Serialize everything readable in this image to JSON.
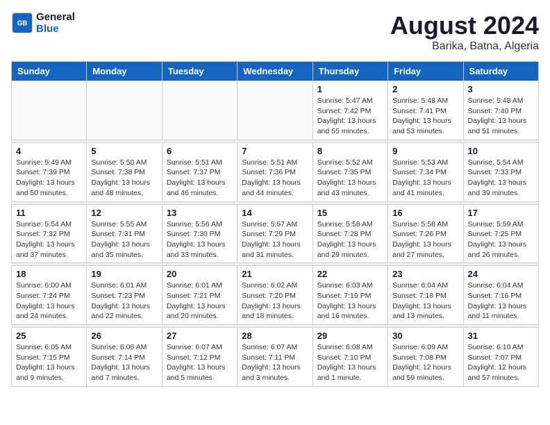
{
  "header": {
    "logo_line1": "General",
    "logo_line2": "Blue",
    "month_year": "August 2024",
    "location": "Barika, Batna, Algeria"
  },
  "weekdays": [
    "Sunday",
    "Monday",
    "Tuesday",
    "Wednesday",
    "Thursday",
    "Friday",
    "Saturday"
  ],
  "weeks": [
    [
      {
        "day": "",
        "detail": ""
      },
      {
        "day": "",
        "detail": ""
      },
      {
        "day": "",
        "detail": ""
      },
      {
        "day": "",
        "detail": ""
      },
      {
        "day": "1",
        "detail": "Sunrise: 5:47 AM\nSunset: 7:42 PM\nDaylight: 13 hours\nand 55 minutes."
      },
      {
        "day": "2",
        "detail": "Sunrise: 5:48 AM\nSunset: 7:41 PM\nDaylight: 13 hours\nand 53 minutes."
      },
      {
        "day": "3",
        "detail": "Sunrise: 5:48 AM\nSunset: 7:40 PM\nDaylight: 13 hours\nand 51 minutes."
      }
    ],
    [
      {
        "day": "4",
        "detail": "Sunrise: 5:49 AM\nSunset: 7:39 PM\nDaylight: 13 hours\nand 50 minutes."
      },
      {
        "day": "5",
        "detail": "Sunrise: 5:50 AM\nSunset: 7:38 PM\nDaylight: 13 hours\nand 48 minutes."
      },
      {
        "day": "6",
        "detail": "Sunrise: 5:51 AM\nSunset: 7:37 PM\nDaylight: 13 hours\nand 46 minutes."
      },
      {
        "day": "7",
        "detail": "Sunrise: 5:51 AM\nSunset: 7:36 PM\nDaylight: 13 hours\nand 44 minutes."
      },
      {
        "day": "8",
        "detail": "Sunrise: 5:52 AM\nSunset: 7:35 PM\nDaylight: 13 hours\nand 43 minutes."
      },
      {
        "day": "9",
        "detail": "Sunrise: 5:53 AM\nSunset: 7:34 PM\nDaylight: 13 hours\nand 41 minutes."
      },
      {
        "day": "10",
        "detail": "Sunrise: 5:54 AM\nSunset: 7:33 PM\nDaylight: 13 hours\nand 39 minutes."
      }
    ],
    [
      {
        "day": "11",
        "detail": "Sunrise: 5:54 AM\nSunset: 7:32 PM\nDaylight: 13 hours\nand 37 minutes."
      },
      {
        "day": "12",
        "detail": "Sunrise: 5:55 AM\nSunset: 7:31 PM\nDaylight: 13 hours\nand 35 minutes."
      },
      {
        "day": "13",
        "detail": "Sunrise: 5:56 AM\nSunset: 7:30 PM\nDaylight: 13 hours\nand 33 minutes."
      },
      {
        "day": "14",
        "detail": "Sunrise: 5:57 AM\nSunset: 7:29 PM\nDaylight: 13 hours\nand 31 minutes."
      },
      {
        "day": "15",
        "detail": "Sunrise: 5:58 AM\nSunset: 7:28 PM\nDaylight: 13 hours\nand 29 minutes."
      },
      {
        "day": "16",
        "detail": "Sunrise: 5:58 AM\nSunset: 7:26 PM\nDaylight: 13 hours\nand 27 minutes."
      },
      {
        "day": "17",
        "detail": "Sunrise: 5:59 AM\nSunset: 7:25 PM\nDaylight: 13 hours\nand 26 minutes."
      }
    ],
    [
      {
        "day": "18",
        "detail": "Sunrise: 6:00 AM\nSunset: 7:24 PM\nDaylight: 13 hours\nand 24 minutes."
      },
      {
        "day": "19",
        "detail": "Sunrise: 6:01 AM\nSunset: 7:23 PM\nDaylight: 13 hours\nand 22 minutes."
      },
      {
        "day": "20",
        "detail": "Sunrise: 6:01 AM\nSunset: 7:21 PM\nDaylight: 13 hours\nand 20 minutes."
      },
      {
        "day": "21",
        "detail": "Sunrise: 6:02 AM\nSunset: 7:20 PM\nDaylight: 13 hours\nand 18 minutes."
      },
      {
        "day": "22",
        "detail": "Sunrise: 6:03 AM\nSunset: 7:19 PM\nDaylight: 13 hours\nand 16 minutes."
      },
      {
        "day": "23",
        "detail": "Sunrise: 6:04 AM\nSunset: 7:18 PM\nDaylight: 13 hours\nand 13 minutes."
      },
      {
        "day": "24",
        "detail": "Sunrise: 6:04 AM\nSunset: 7:16 PM\nDaylight: 13 hours\nand 11 minutes."
      }
    ],
    [
      {
        "day": "25",
        "detail": "Sunrise: 6:05 AM\nSunset: 7:15 PM\nDaylight: 13 hours\nand 9 minutes."
      },
      {
        "day": "26",
        "detail": "Sunrise: 6:06 AM\nSunset: 7:14 PM\nDaylight: 13 hours\nand 7 minutes."
      },
      {
        "day": "27",
        "detail": "Sunrise: 6:07 AM\nSunset: 7:12 PM\nDaylight: 13 hours\nand 5 minutes."
      },
      {
        "day": "28",
        "detail": "Sunrise: 6:07 AM\nSunset: 7:11 PM\nDaylight: 13 hours\nand 3 minutes."
      },
      {
        "day": "29",
        "detail": "Sunrise: 6:08 AM\nSunset: 7:10 PM\nDaylight: 13 hours\nand 1 minute."
      },
      {
        "day": "30",
        "detail": "Sunrise: 6:09 AM\nSunset: 7:08 PM\nDaylight: 12 hours\nand 59 minutes."
      },
      {
        "day": "31",
        "detail": "Sunrise: 6:10 AM\nSunset: 7:07 PM\nDaylight: 12 hours\nand 57 minutes."
      }
    ]
  ]
}
